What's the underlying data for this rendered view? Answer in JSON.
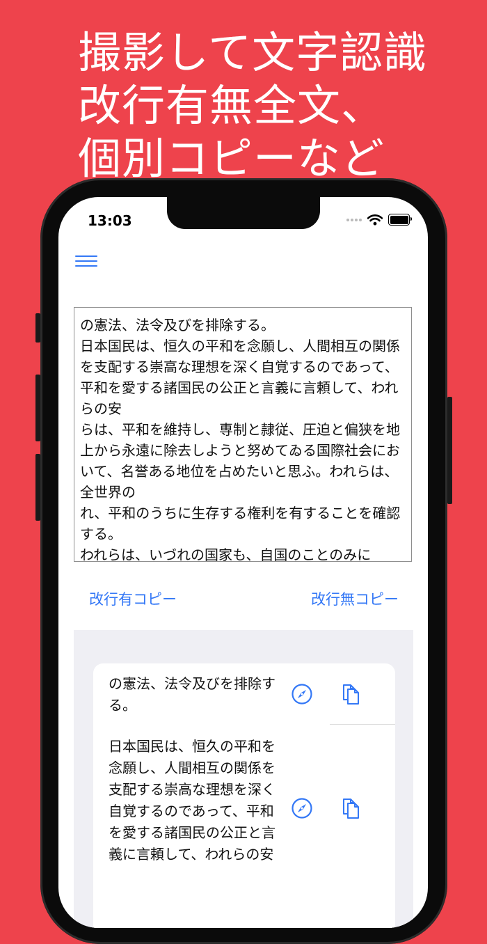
{
  "headline": {
    "line1": "撮影して文字認識",
    "line2": "改行有無全文、",
    "line3": "個別コピーなど"
  },
  "status_bar": {
    "time": "13:03"
  },
  "ocr_text": "の憲法、法令及びを排除する。\n日本国民は、恒久の平和を念願し、人間相互の関係を支配する崇高な理想を深く自覚するのであって、平和を愛する諸国民の公正と言義に言頼して、われらの安\nらは、平和を維持し、専制と隷従、圧迫と偏狭を地上から永遠に除去しようと努めてゐる国際社会において、名誉ある地位を占めたいと思ふ。われらは、全世界の\nれ、平和のうちに生存する権利を有することを確認する。\nわれらは、いづれの国家も、自国のことのみに",
  "actions": {
    "copy_with_breaks": "改行有コピー",
    "copy_without_breaks": "改行無コピー"
  },
  "segments": [
    {
      "text": "の憲法、法令及びを排除する。"
    },
    {
      "text": "日本国民は、恒久の平和を念願し、人間相互の関係を支配する崇高な理想を深く自覚するのであって、平和を愛する諸国民の公正と言義に言頼して、われらの安"
    }
  ],
  "colors": {
    "background": "#EE434C",
    "accent": "#3478F6",
    "list_background": "#EFEFF4"
  },
  "icons": {
    "menu": "hamburger-menu-icon",
    "browser": "compass-icon",
    "copy": "copy-documents-icon"
  }
}
